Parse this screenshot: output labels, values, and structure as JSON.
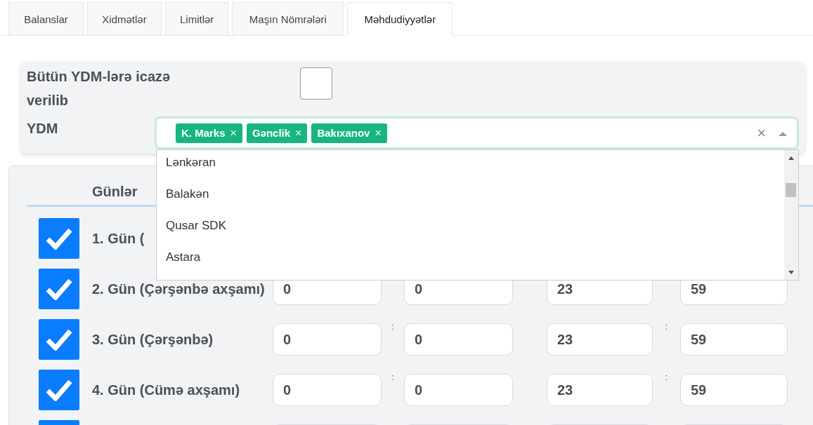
{
  "tabs": [
    {
      "label": "Balanslar",
      "selected": false
    },
    {
      "label": "Xidmətlər",
      "selected": false
    },
    {
      "label": "Limitlər",
      "selected": false
    },
    {
      "label": "Maşın Nömrələri",
      "selected": false
    },
    {
      "label": "Məhdudiyyətlər",
      "selected": true
    }
  ],
  "permission": {
    "label": "Bütün YDM-lərə icazə verilib",
    "checked": false
  },
  "ydm": {
    "label": "YDM",
    "tags": [
      {
        "label": "K. Marks",
        "remove": "×"
      },
      {
        "label": "Gənclik",
        "remove": "×"
      },
      {
        "label": "Bakıxanov",
        "remove": "×"
      }
    ],
    "clear": "×",
    "expanded": true,
    "options": [
      "Lənkəran",
      "Balakən",
      "Qusar SDK",
      "Astara"
    ]
  },
  "days": {
    "header": "Günlər",
    "rows": [
      {
        "label": "1. Gün (",
        "checked": true
      },
      {
        "label": "2. Gün (Çərşənbə axşamı)",
        "checked": true,
        "times": [
          "0",
          "0",
          "23",
          "59"
        ]
      },
      {
        "label": "3. Gün (Çərşənbə)",
        "checked": true,
        "times": [
          "0",
          "0",
          "23",
          "59"
        ],
        "separators": [
          ":",
          ":"
        ]
      },
      {
        "label": "4. Gün (Cümə axşamı)",
        "checked": true,
        "times": [
          "0",
          "0",
          "23",
          "59"
        ],
        "separators": [
          ":",
          ":"
        ]
      },
      {
        "checked": true
      }
    ]
  }
}
